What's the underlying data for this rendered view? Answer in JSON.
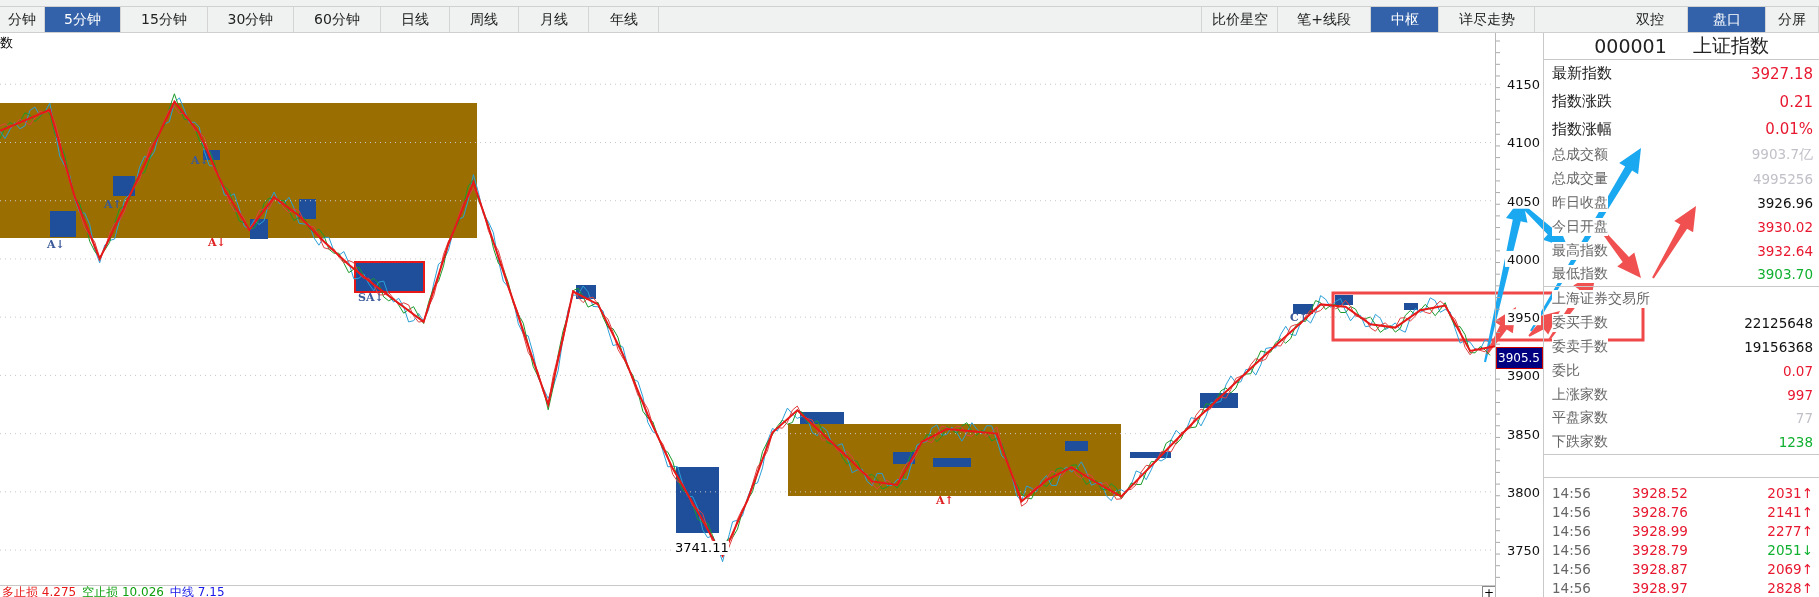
{
  "top_tabs": {
    "left": [
      {
        "label": "分钟",
        "selected": false
      },
      {
        "label": "5分钟",
        "selected": true
      },
      {
        "label": "15分钟",
        "selected": false
      },
      {
        "label": "30分钟",
        "selected": false
      },
      {
        "label": "60分钟",
        "selected": false
      },
      {
        "label": "日线",
        "selected": false
      },
      {
        "label": "周线",
        "selected": false
      },
      {
        "label": "月线",
        "selected": false
      },
      {
        "label": "年线",
        "selected": false
      }
    ],
    "right": [
      {
        "label": "比价星空",
        "selected": false
      },
      {
        "label": "笔+线段",
        "selected": false
      },
      {
        "label": "中枢",
        "selected": true
      },
      {
        "label": "详尽走势",
        "selected": false
      }
    ],
    "panel": [
      {
        "label": "双控",
        "selected": false
      },
      {
        "label": "盘口",
        "selected": true
      },
      {
        "label": "分屏",
        "selected": false
      }
    ]
  },
  "chart": {
    "title": "数",
    "current_price": "3905.5",
    "low_label": "3741.11",
    "chart_data": {
      "type": "line",
      "grid": true,
      "ylim": [
        3708,
        4194
      ],
      "yticks": [
        4150,
        4100,
        4050,
        4000,
        3950,
        3900,
        3850,
        3800,
        3750
      ],
      "series": [
        {
          "color": "#e81818",
          "values": [
            4110,
            4119,
            4128,
            4053,
            4000,
            4045,
            4090,
            4135,
            4108,
            4060,
            4025,
            4053,
            4037,
            4015,
            3995,
            3978,
            3962,
            3946,
            4013,
            4066,
            4002,
            3938,
            3875,
            3972,
            3961,
            3918,
            3866,
            3820,
            3783,
            3745,
            3793,
            3851,
            3870,
            3850,
            3830,
            3809,
            3806,
            3843,
            3854,
            3852,
            3850,
            3792,
            3810,
            3821,
            3808,
            3796,
            3818,
            3840,
            3862,
            3882,
            3902,
            3922,
            3941,
            3961,
            3959,
            3944,
            3941,
            3956,
            3960,
            3921,
            3925
          ]
        }
      ]
    },
    "markers": [
      {
        "text": "A↓",
        "color": "#3a5a9a"
      },
      {
        "text": "A↑",
        "color": "#3a5a9a"
      },
      {
        "text": "A↓",
        "color": "#3a5a9a"
      },
      {
        "text": "A↓",
        "color": "#e02020"
      },
      {
        "text": "SA↓",
        "color": "#3a5a9a"
      },
      {
        "text": "A↑",
        "color": "#e02020"
      },
      {
        "text": "C↑",
        "color": "#3a5a9a"
      }
    ],
    "indicators": [
      {
        "text": "多止损 4.275",
        "color": "#e81818"
      },
      {
        "text": "空止损 10.026",
        "color": "#10a010"
      },
      {
        "text": "中线 7.15",
        "color": "#1818e8"
      }
    ],
    "zoom_button": "+"
  },
  "quote": {
    "code": "000001",
    "name": "上证指数",
    "main": [
      {
        "label": "最新指数",
        "value": "3927.18",
        "color": "#e81830"
      },
      {
        "label": "指数涨跌",
        "value": "0.21",
        "color": "#e81830"
      },
      {
        "label": "指数涨幅",
        "value": "0.01%",
        "color": "#e81830"
      }
    ],
    "stats": [
      {
        "label": "总成交额",
        "value": "9903.7亿",
        "color": "#c0c0c8"
      },
      {
        "label": "总成交量",
        "value": "4995256",
        "color": "#c0c0c8"
      },
      {
        "label": "昨日收盘",
        "value": "3926.96",
        "color": "#111111"
      },
      {
        "label": "今日开盘",
        "value": "3930.02",
        "color": "#e81830"
      },
      {
        "label": "最高指数",
        "value": "3932.64",
        "color": "#e81830"
      },
      {
        "label": "最低指数",
        "value": "3903.70",
        "color": "#10b030"
      }
    ],
    "exchange": "上海证券交易所",
    "orders": [
      {
        "label": "委买手数",
        "value": "22125648",
        "color": "#111111"
      },
      {
        "label": "委卖手数",
        "value": "19156368",
        "color": "#111111"
      },
      {
        "label": "委比",
        "value": "0.07",
        "color": "#e81830"
      },
      {
        "label": "上涨家数",
        "value": "997",
        "color": "#e81830"
      },
      {
        "label": "平盘家数",
        "value": "77",
        "color": "#c0c0c8"
      },
      {
        "label": "下跌家数",
        "value": "1238",
        "color": "#10b030"
      }
    ],
    "ticks": [
      {
        "time": "14:56",
        "price": "3928.52",
        "volume": "2031↑",
        "color": "#e81830"
      },
      {
        "time": "14:56",
        "price": "3928.76",
        "volume": "2141↑",
        "color": "#e81830"
      },
      {
        "time": "14:56",
        "price": "3928.99",
        "volume": "2277↑",
        "color": "#e81830"
      },
      {
        "time": "14:56",
        "price": "3928.79",
        "volume": "2051↓",
        "color": "#10b030"
      },
      {
        "time": "14:56",
        "price": "3928.87",
        "volume": "2069↑",
        "color": "#e81830"
      },
      {
        "time": "14:56",
        "price": "3928.97",
        "volume": "2828↑",
        "color": "#e81830"
      }
    ]
  }
}
